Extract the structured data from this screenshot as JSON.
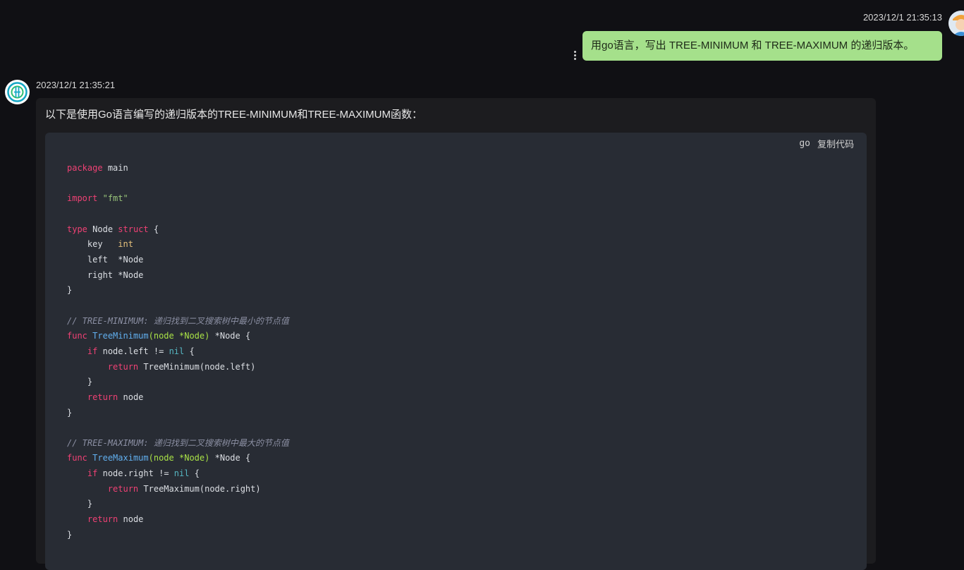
{
  "user_message": {
    "timestamp": "2023/12/1 21:35:13",
    "text": "用go语言，写出 TREE-MINIMUM 和 TREE-MAXIMUM 的递归版本。",
    "bubble_color": "#a5e08b"
  },
  "bot_message": {
    "timestamp": "2023/12/1 21:35:21",
    "intro": "以下是使用Go语言编写的递归版本的TREE-MINIMUM和TREE-MAXIMUM函数：",
    "code_block": {
      "language": "go",
      "copy_label": "复制代码",
      "lines": [
        "package main",
        "",
        "import \"fmt\"",
        "",
        "type Node struct {",
        "    key   int",
        "    left  *Node",
        "    right *Node",
        "}",
        "",
        "// TREE-MINIMUM: 递归找到二叉搜索树中最小的节点值",
        "func TreeMinimum(node *Node) *Node {",
        "    if node.left != nil {",
        "        return TreeMinimum(node.left)",
        "    }",
        "    return node",
        "}",
        "",
        "// TREE-MAXIMUM: 递归找到二叉搜索树中最大的节点值",
        "func TreeMaximum(node *Node) *Node {",
        "    if node.right != nil {",
        "        return TreeMaximum(node.right)",
        "    }",
        "    return node",
        "}"
      ]
    }
  },
  "icons": {
    "more": "vertical-ellipsis-icon",
    "user_avatar": "user-avatar-icon",
    "bot_avatar": "bot-logo-icon"
  },
  "colors": {
    "background": "#101014",
    "card": "#1c1c1f",
    "code_bg": "#282c34",
    "keyword": "#ef4174",
    "function": "#61afef",
    "string": "#98c379"
  }
}
